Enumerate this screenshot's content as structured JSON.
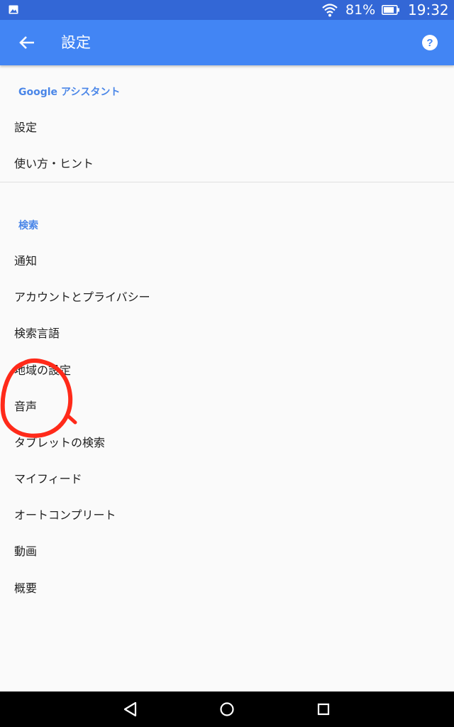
{
  "status_bar": {
    "battery_percent": "81%",
    "time": "19:32",
    "icons": [
      "gallery-icon",
      "wifi-icon",
      "battery-icon"
    ]
  },
  "app_bar": {
    "title": "設定",
    "icons": [
      "back-arrow-icon",
      "help-icon"
    ],
    "color": "#4285f4"
  },
  "sections": [
    {
      "header": "Google アシスタント",
      "items": [
        "設定",
        "使い方・ヒント"
      ]
    },
    {
      "header": "検索",
      "items": [
        "通知",
        "アカウントとプライバシー",
        "検索言語",
        "地域の設定",
        "音声",
        "タブレットの検索",
        "マイフィード",
        "オートコンプリート",
        "動画",
        "概要"
      ]
    }
  ],
  "annotation": {
    "type": "hand-drawn circle",
    "color": "#ff2a1a"
  },
  "nav_bar": {
    "icons": [
      "back-triangle-icon",
      "home-circle-icon",
      "recents-square-icon"
    ]
  }
}
